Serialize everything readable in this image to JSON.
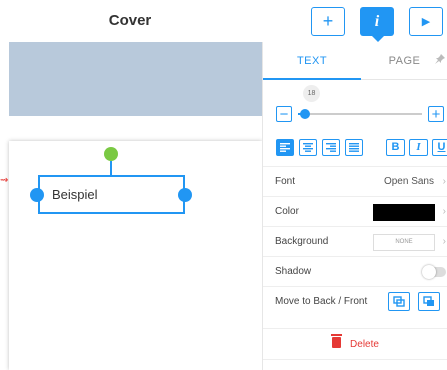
{
  "header": {
    "title": "Cover",
    "add_button": "+",
    "info_button": "i",
    "play_button": "▶"
  },
  "canvas": {
    "text_box_content": "Beispiel",
    "arrow_indicator": "⇝"
  },
  "panel": {
    "tabs": [
      {
        "label": "TEXT",
        "active": true
      },
      {
        "label": "PAGE",
        "active": false
      }
    ],
    "font_size": "18",
    "font_size_fraction": 0.06,
    "minus": "−",
    "plus": "+",
    "style_buttons": {
      "bold": "B",
      "italic": "I",
      "underline": "U"
    },
    "font": {
      "label": "Font",
      "value": "Open Sans"
    },
    "color": {
      "label": "Color",
      "value": "#000000"
    },
    "background": {
      "label": "Background",
      "value": "NONE"
    },
    "shadow": {
      "label": "Shadow",
      "enabled": false
    },
    "layer": {
      "label": "Move to Back / Front"
    },
    "delete": {
      "label": "Delete"
    },
    "chevron": "›"
  },
  "colors": {
    "accent": "#2196f3",
    "rotate_handle": "#7ac943",
    "danger": "#e53935",
    "cover_band": "#b8c9db"
  }
}
